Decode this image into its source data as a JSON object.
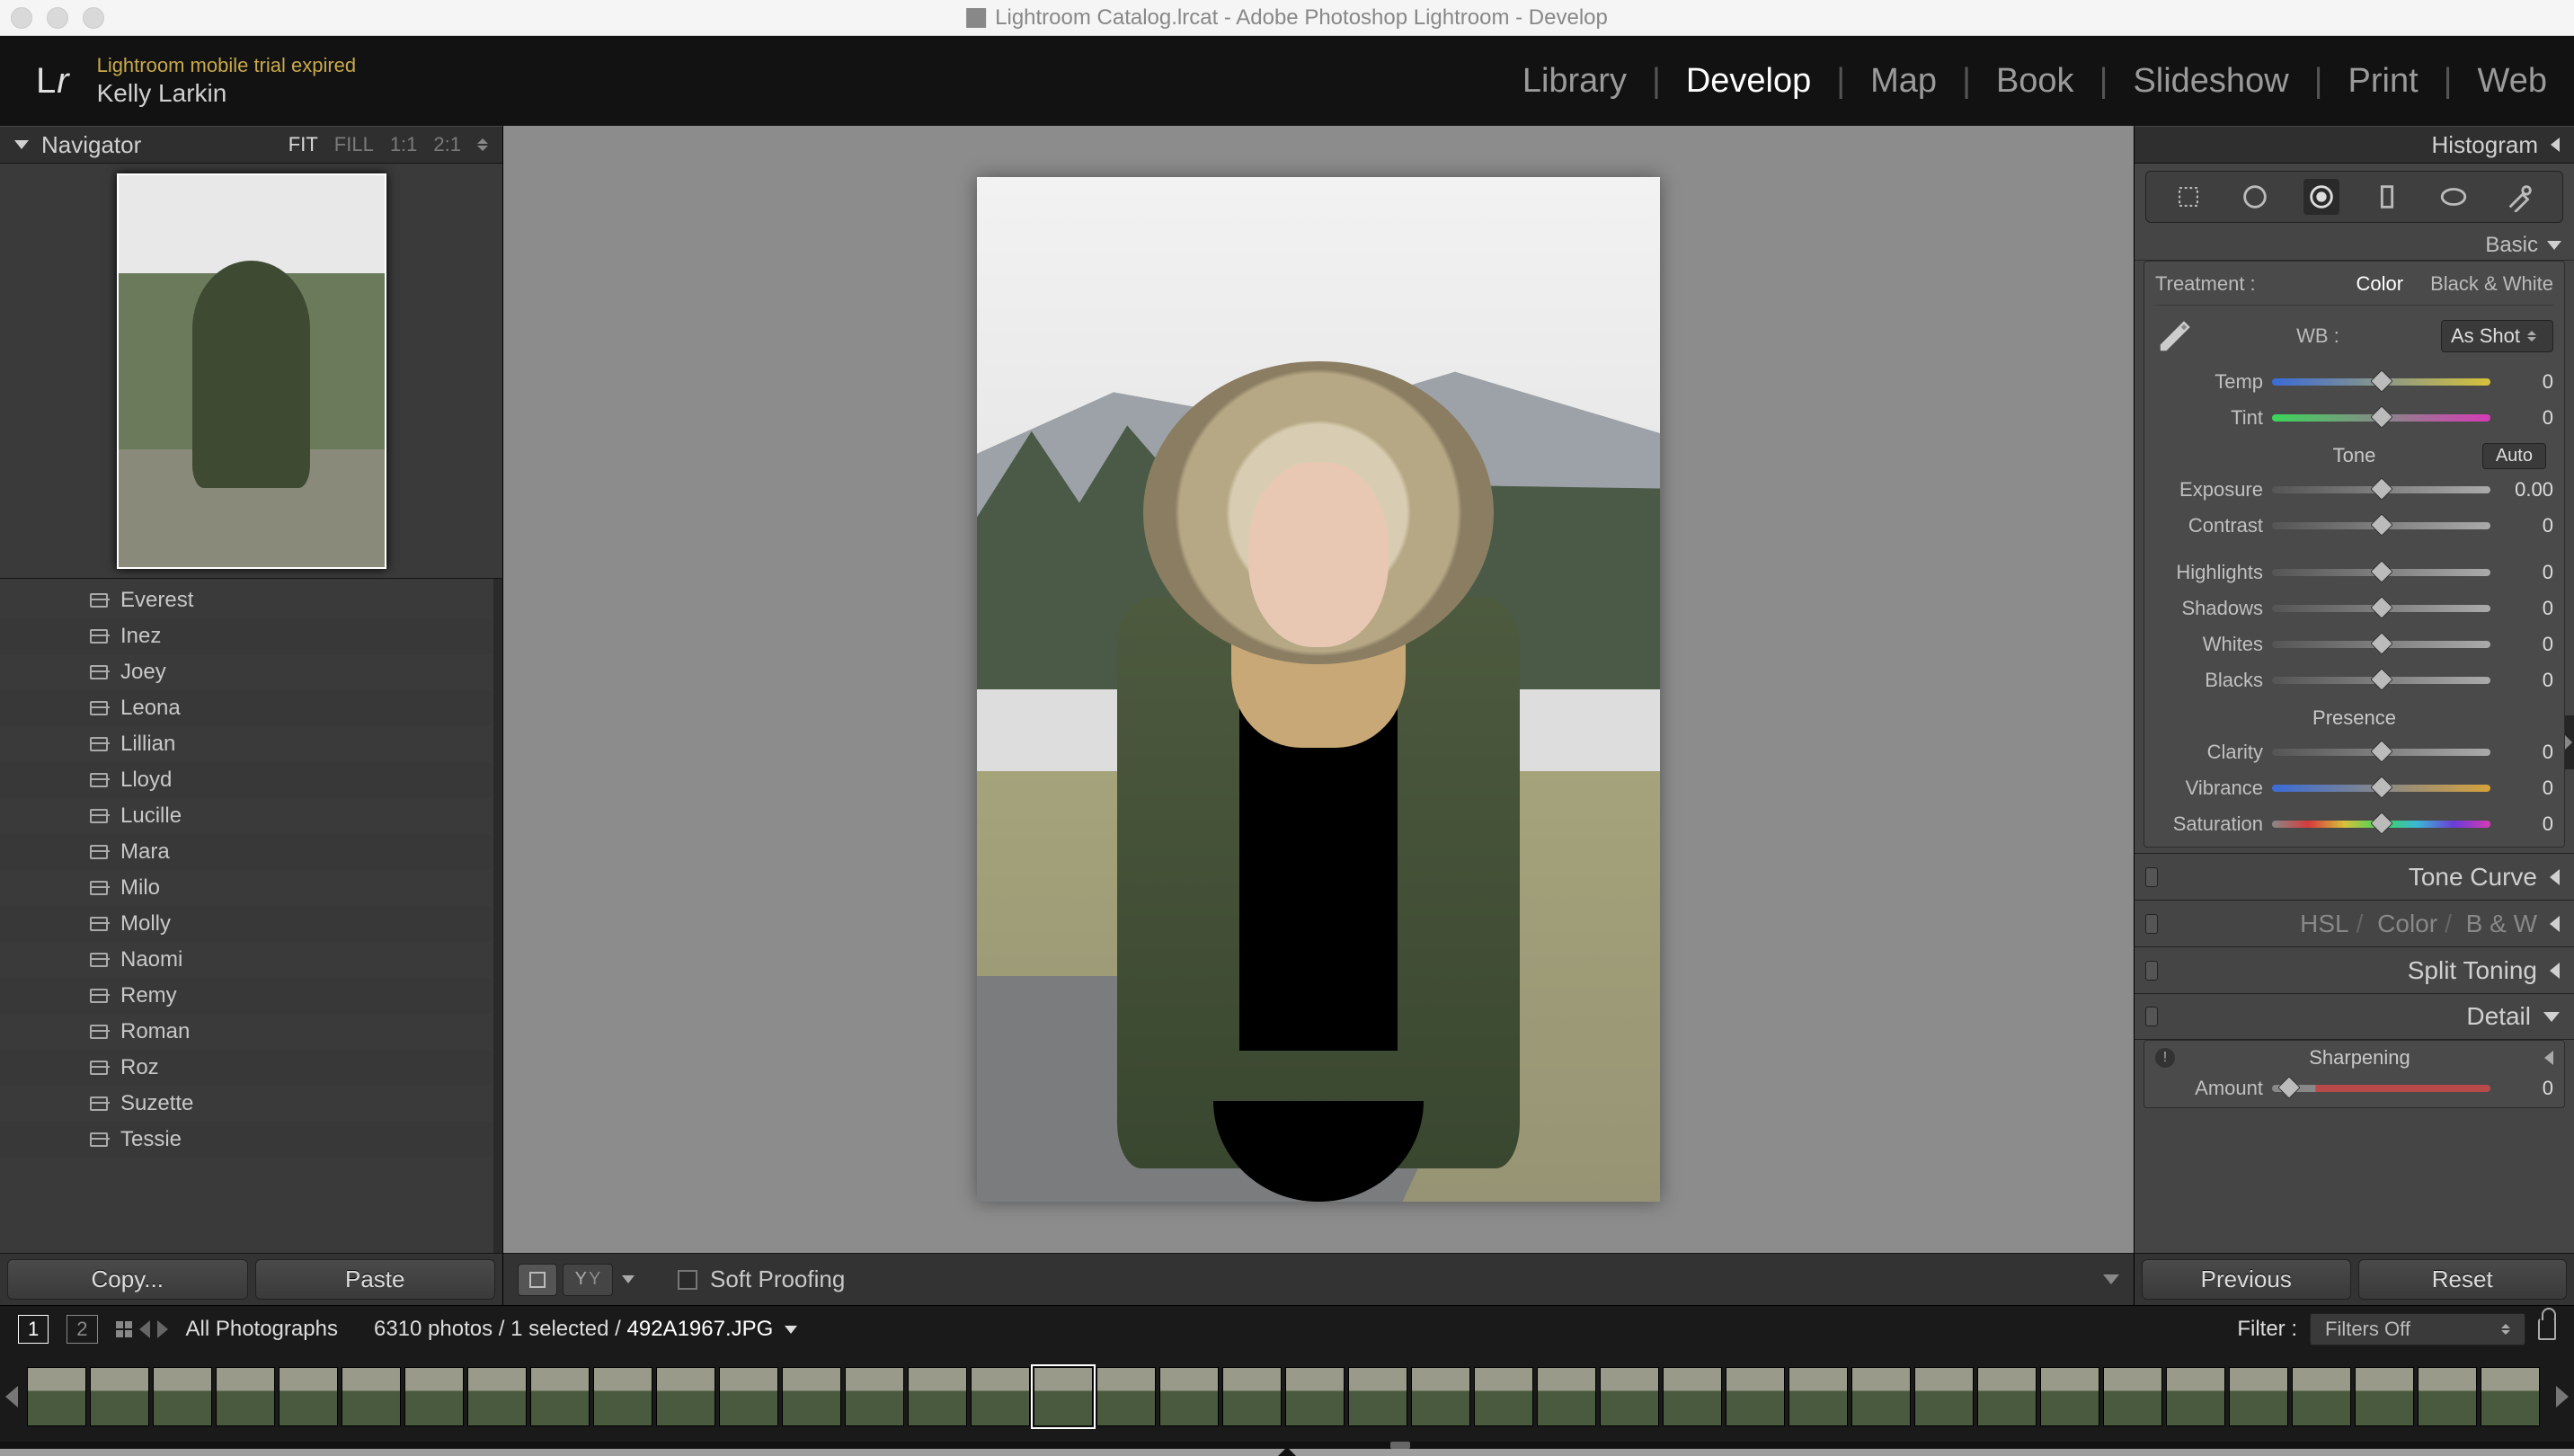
{
  "window": {
    "title": "Lightroom Catalog.lrcat - Adobe Photoshop Lightroom - Develop"
  },
  "identity": {
    "logo": "Lr",
    "trial": "Lightroom mobile trial expired",
    "user": "Kelly Larkin"
  },
  "modules": {
    "library": "Library",
    "develop": "Develop",
    "map": "Map",
    "book": "Book",
    "slideshow": "Slideshow",
    "print": "Print",
    "web": "Web",
    "active": "Develop"
  },
  "navigator": {
    "title": "Navigator",
    "zoom": {
      "fit": "FIT",
      "fill": "FILL",
      "one": "1:1",
      "two": "2:1"
    }
  },
  "collections": [
    "Everest",
    "Inez",
    "Joey",
    "Leona",
    "Lillian",
    "Lloyd",
    "Lucille",
    "Mara",
    "Milo",
    "Molly",
    "Naomi",
    "Remy",
    "Roman",
    "Roz",
    "Suzette",
    "Tessie"
  ],
  "left_buttons": {
    "copy": "Copy...",
    "paste": "Paste"
  },
  "toolbar": {
    "soft_proofing": "Soft Proofing"
  },
  "right": {
    "histogram": "Histogram",
    "basic": "Basic",
    "treatment_label": "Treatment :",
    "treatment_color": "Color",
    "treatment_bw": "Black & White",
    "wb_label": "WB :",
    "wb_value": "As Shot",
    "temp": {
      "label": "Temp",
      "value": "0"
    },
    "tint": {
      "label": "Tint",
      "value": "0"
    },
    "tone_title": "Tone",
    "auto": "Auto",
    "exposure": {
      "label": "Exposure",
      "value": "0.00"
    },
    "contrast": {
      "label": "Contrast",
      "value": "0"
    },
    "highlights": {
      "label": "Highlights",
      "value": "0"
    },
    "shadows": {
      "label": "Shadows",
      "value": "0"
    },
    "whites": {
      "label": "Whites",
      "value": "0"
    },
    "blacks": {
      "label": "Blacks",
      "value": "0"
    },
    "presence": "Presence",
    "clarity": {
      "label": "Clarity",
      "value": "0"
    },
    "vibrance": {
      "label": "Vibrance",
      "value": "0"
    },
    "saturation": {
      "label": "Saturation",
      "value": "0"
    },
    "tone_curve": "Tone Curve",
    "hsl": {
      "hsl": "HSL",
      "color": "Color",
      "bw": "B & W"
    },
    "split_toning": "Split Toning",
    "detail": "Detail",
    "sharpening": "Sharpening",
    "amount": {
      "label": "Amount",
      "value": "0"
    }
  },
  "right_buttons": {
    "previous": "Previous",
    "reset": "Reset"
  },
  "filmstrip": {
    "grid1": "1",
    "grid2": "2",
    "source": "All Photographs",
    "count_line_a": "6310 photos / 1 selected /",
    "filename": "492A1967.JPG",
    "filter_label": "Filter :",
    "filter_value": "Filters Off"
  }
}
